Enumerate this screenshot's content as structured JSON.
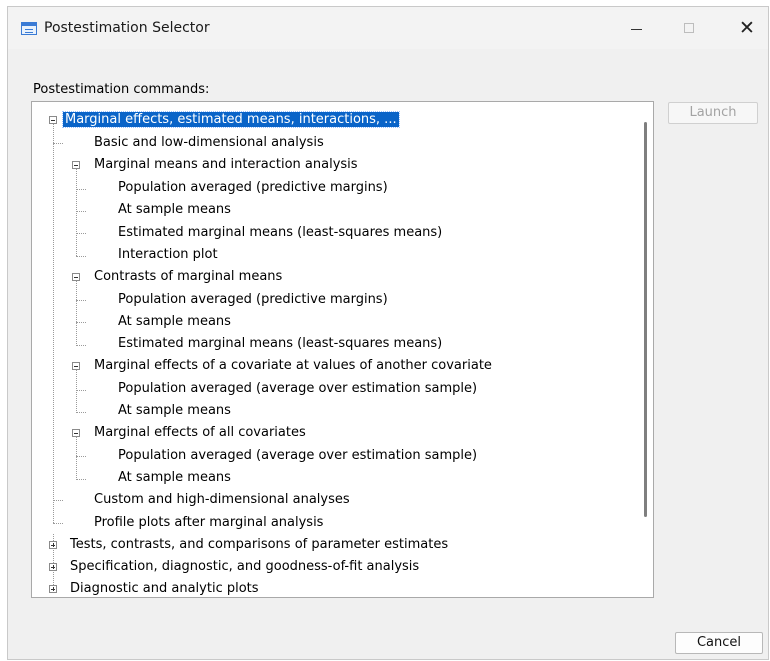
{
  "window": {
    "title": "Postestimation Selector",
    "controls": {
      "minimize": "—",
      "maximize": "☐",
      "close": "✕"
    }
  },
  "panel": {
    "label": "Postestimation commands:"
  },
  "tree": {
    "n0": "Marginal effects, estimated means, interactions, ...",
    "n1": "Basic and low-dimensional analysis",
    "n2": "Marginal means and interaction analysis",
    "n3": "Population averaged (predictive margins)",
    "n4": "At sample means",
    "n5": "Estimated marginal means (least-squares means)",
    "n6": "Interaction plot",
    "n7": "Contrasts of marginal means",
    "n8": "Population averaged (predictive margins)",
    "n9": "At sample means",
    "n10": "Estimated marginal means (least-squares means)",
    "n11": "Marginal effects of a covariate at values of another covariate",
    "n12": "Population averaged (average over estimation sample)",
    "n13": "At sample means",
    "n14": "Marginal effects of all covariates",
    "n15": "Population averaged (average over estimation sample)",
    "n16": "At sample means",
    "n17": "Custom and high-dimensional analyses",
    "n18": "Profile plots after marginal analysis",
    "n19": "Tests, contrasts, and comparisons of parameter estimates",
    "n20": "Specification, diagnostic, and goodness-of-fit analysis",
    "n21": "Diagnostic and analytic plots"
  },
  "buttons": {
    "launch": "Launch",
    "cancel": "Cancel"
  },
  "colors": {
    "selection": "#0a64c8",
    "window_bg": "#f0f0f0",
    "disabled_text": "#a3a3a3"
  }
}
